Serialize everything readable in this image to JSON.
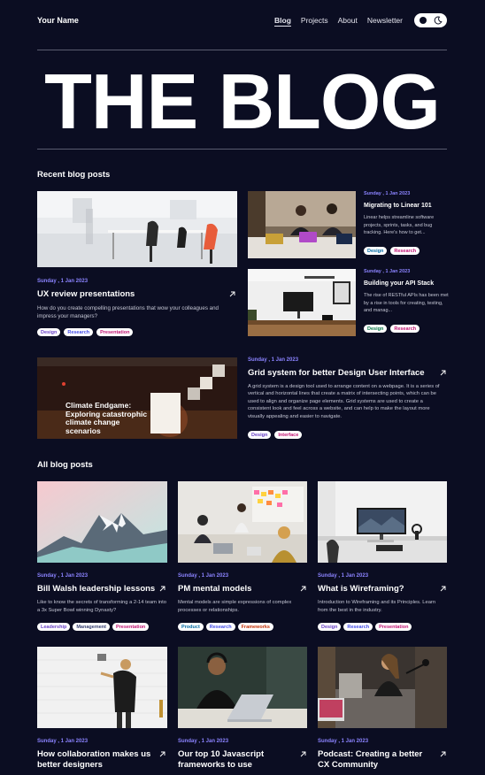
{
  "nav": {
    "brand": "Your Name",
    "links": [
      "Blog",
      "Projects",
      "About",
      "Newsletter"
    ]
  },
  "hero": {
    "title": "THE BLOG"
  },
  "recent": {
    "title": "Recent blog posts",
    "posts": [
      {
        "date": "Sunday , 1 Jan 2023",
        "title": "UX review presentations",
        "desc": "How do you create compelling presentations that wow your colleagues and impress your managers?",
        "tags": [
          "Design",
          "Research",
          "Presentation"
        ]
      },
      {
        "date": "Sunday , 1 Jan 2023",
        "title": "Migrating to Linear 101",
        "desc": "Linear helps streamline software projects, sprints, tasks, and bug tracking. Here's how to get...",
        "tags": [
          "Design",
          "Research"
        ]
      },
      {
        "date": "Sunday , 1 Jan 2023",
        "title": "Building your API Stack",
        "desc": "The rise of RESTful APIs has been met by a rise in tools for creating, testing, and manag...",
        "tags": [
          "Design",
          "Research"
        ]
      },
      {
        "date": "Sunday , 1 Jan 2023",
        "title": "Grid system for better Design User Interface",
        "desc": "A grid system is a design tool used to arrange content on a webpage. It is a series of vertical and horizontal lines that create a matrix of intersecting points, which can be used to align and organize page elements. Grid systems are used to create a consistent look and feel across a website, and can help to make the layout more visually appealing and easier to navigate.",
        "tags": [
          "Design",
          "Interface"
        ]
      }
    ],
    "climate_image_text": "Climate Endgame: Exploring catastrophic climate change scenarios"
  },
  "all": {
    "title": "All blog posts",
    "posts": [
      {
        "date": "Sunday , 1 Jan 2023",
        "title": "Bill Walsh leadership lessons",
        "desc": "Like to know the secrets of transforming a 2-14 team into a 3x Super Bowl winning Dynasty?",
        "tags": [
          "Leadership",
          "Management",
          "Presentation"
        ]
      },
      {
        "date": "Sunday , 1 Jan 2023",
        "title": "PM mental models",
        "desc": "Mental models are simple expressions of complex processes or relationships.",
        "tags": [
          "Product",
          "Research",
          "Frameworks"
        ]
      },
      {
        "date": "Sunday , 1 Jan 2023",
        "title": "What is Wireframing?",
        "desc": "Introduction to Wireframing and its Principles. Learn from the best in the industry.",
        "tags": [
          "Design",
          "Research",
          "Presentation"
        ]
      },
      {
        "date": "Sunday , 1 Jan 2023",
        "title": "How collaboration makes us better designers"
      },
      {
        "date": "Sunday , 1 Jan 2023",
        "title": "Our top 10 Javascript frameworks to use"
      },
      {
        "date": "Sunday , 1 Jan 2023",
        "title": "Podcast: Creating a better CX Community"
      }
    ]
  }
}
